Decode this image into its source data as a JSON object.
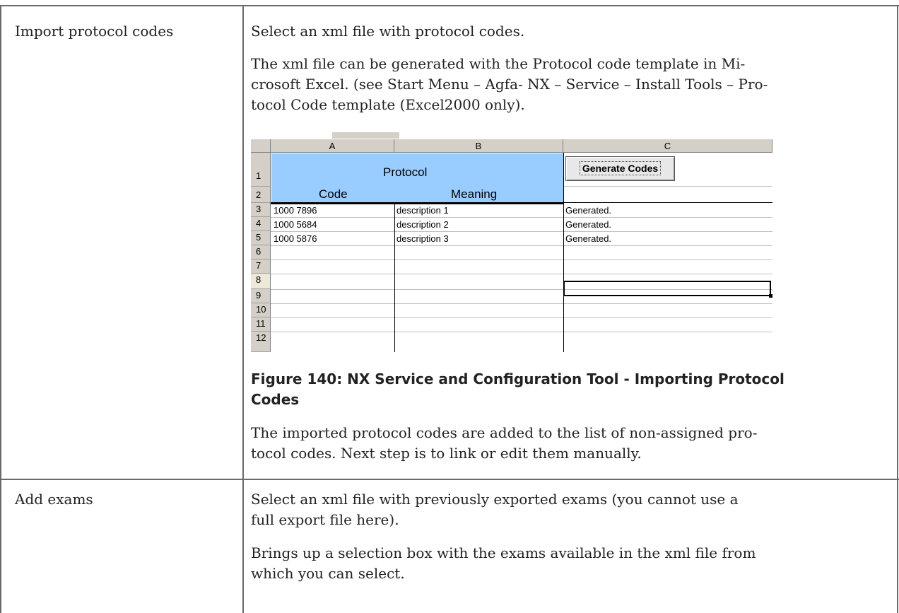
{
  "rows": [
    {
      "label": "Import protocol codes",
      "paragraphs": [
        "Select an xml file with protocol codes.",
        "The xml file can be generated with the Protocol code template in Mi-",
        "crosoft Excel. (see Start Menu – Agfa- NX – Service – Install Tools – Pro-",
        "tocol Code template (Excel2000 only)."
      ],
      "figure": {
        "columns": [
          "A",
          "B",
          "C"
        ],
        "row_numbers": [
          "1",
          "2",
          "3",
          "4",
          "5",
          "6",
          "7",
          "8",
          "9",
          "10",
          "11",
          "12"
        ],
        "header_protocol": "Protocol",
        "header_code": "Code",
        "header_meaning": "Meaning",
        "button_label": "Generate Codes",
        "data": [
          {
            "code": "1000 7896",
            "meaning": "description 1",
            "status": "Generated."
          },
          {
            "code": "1000 5684",
            "meaning": "description 2",
            "status": "Generated."
          },
          {
            "code": "1000 5876",
            "meaning": "description 3",
            "status": "Generated."
          }
        ],
        "selected_cell": "C8"
      },
      "caption_line1": "Figure 140: NX Service and Configuration Tool - Importing Protocol",
      "caption_line2": "Codes",
      "after_lines": [
        "The imported protocol codes are added to the list of non-assigned pro-",
        "tocol codes. Next step is to link or edit them manually."
      ]
    },
    {
      "label": "Add exams",
      "lines": [
        "Select an xml file with previously exported exams (you cannot use a",
        "full export file here).",
        "Brings up a selection box with the exams available in the xml file from",
        "which you can select."
      ]
    }
  ]
}
